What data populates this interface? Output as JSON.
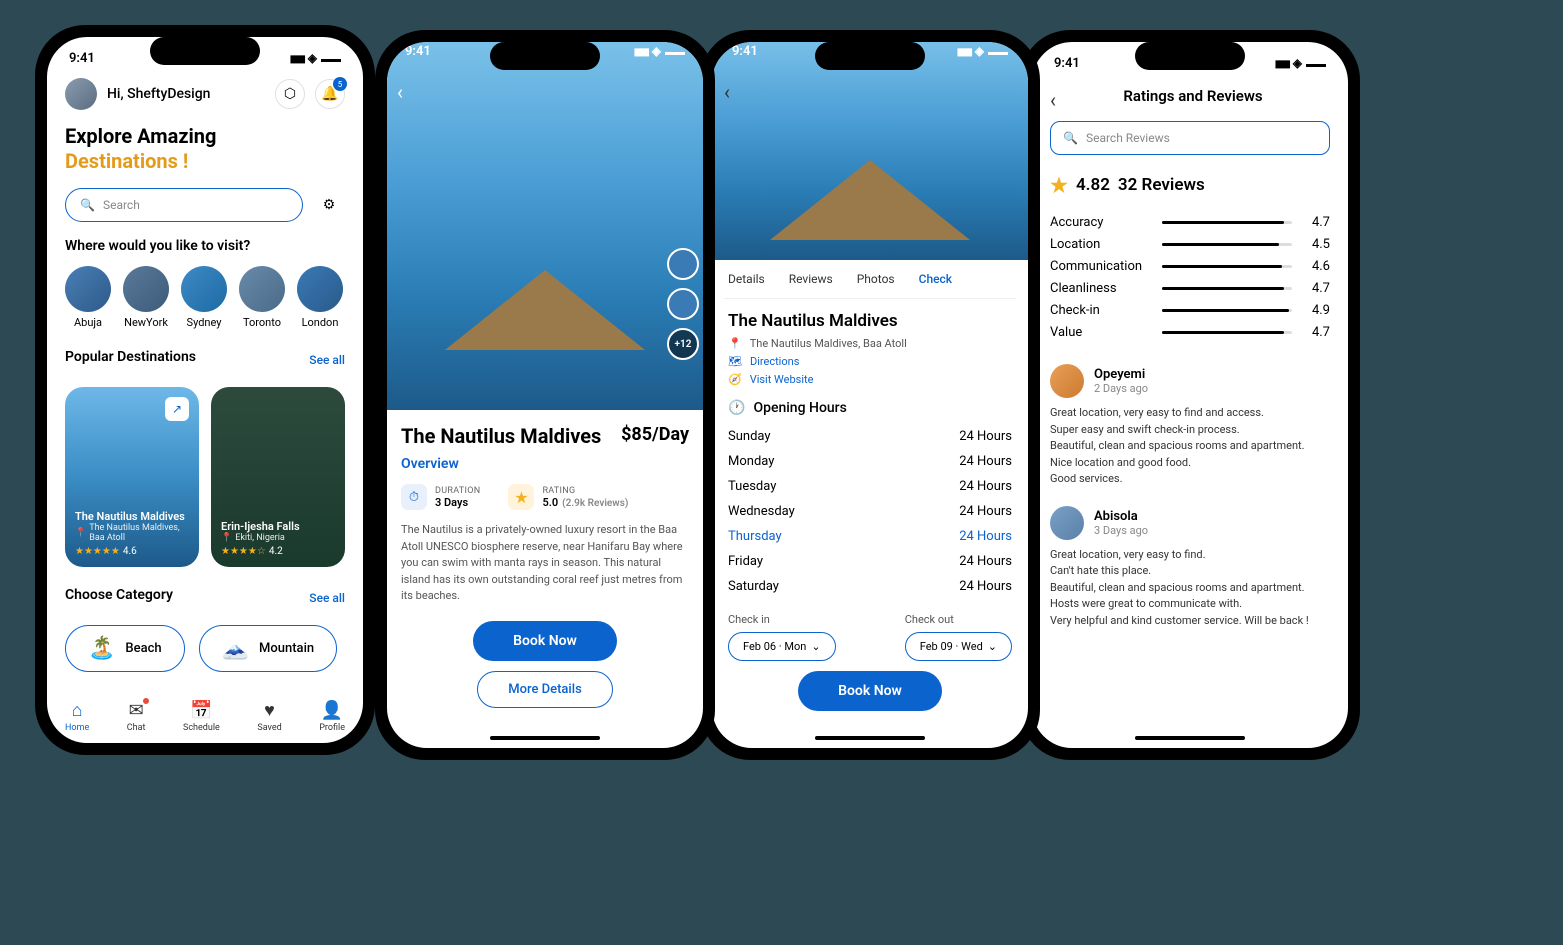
{
  "status": {
    "time": "9:41"
  },
  "screen1": {
    "greeting": "Hi, SheftyDesign",
    "notif_count": "5",
    "hero_line1": "Explore Amazing",
    "hero_line2": "Destinations !",
    "search_placeholder": "Search",
    "visit_question": "Where would you like to visit?",
    "cities": [
      "Abuja",
      "NewYork",
      "Sydney",
      "Toronto",
      "London"
    ],
    "popular_title": "Popular Destinations",
    "see_all": "See all",
    "destinations": [
      {
        "name": "The Nautilus Maldives",
        "location": "The Nautilus Maldives, Baa Atoll",
        "rating": "4.6"
      },
      {
        "name": "Erin-Ijesha Falls",
        "location": "Ekiti, Nigeria",
        "rating": "4.2"
      }
    ],
    "category_title": "Choose Category",
    "categories": [
      {
        "emoji": "🏝️",
        "label": "Beach"
      },
      {
        "emoji": "🗻",
        "label": "Mountain"
      }
    ],
    "nav": [
      "Home",
      "Chat",
      "Schedule",
      "Saved",
      "Profile"
    ]
  },
  "screen2": {
    "thumb_more": "+12",
    "place_name": "The Nautilus Maldives",
    "price": "$85/Day",
    "overview": "Overview",
    "duration_label": "DURATION",
    "duration_value": "3 Days",
    "rating_label": "RATING",
    "rating_value": "5.0",
    "rating_count": "(2.9k Reviews)",
    "description": "The Nautilus is a privately-owned luxury resort in the Baa Atoll UNESCO biosphere reserve, near Hanifaru Bay where you can swim with manta rays in season. This natural island has its own outstanding coral reef just metres from its beaches.",
    "book_now": "Book Now",
    "more_details": "More Details"
  },
  "screen3": {
    "tabs": [
      "Details",
      "Reviews",
      "Photos",
      "Check"
    ],
    "place_name": "The Nautilus Maldives",
    "address": "The Nautilus Maldives, Baa Atoll",
    "directions": "Directions",
    "website": "Visit Website",
    "hours_title": "Opening Hours",
    "hours": [
      {
        "day": "Sunday",
        "time": "24 Hours"
      },
      {
        "day": "Monday",
        "time": "24 Hours"
      },
      {
        "day": "Tuesday",
        "time": "24 Hours"
      },
      {
        "day": "Wednesday",
        "time": "24 Hours"
      },
      {
        "day": "Thursday",
        "time": "24 Hours"
      },
      {
        "day": "Friday",
        "time": "24 Hours"
      },
      {
        "day": "Saturday",
        "time": "24 Hours"
      }
    ],
    "today_index": 4,
    "checkin_label": "Check in",
    "checkout_label": "Check out",
    "checkin_value": "Feb 06 · Mon",
    "checkout_value": "Feb 09 · Wed",
    "book_now": "Book Now"
  },
  "screen4": {
    "page_title": "Ratings and Reviews",
    "search_placeholder": "Search Reviews",
    "avg_rating": "4.82",
    "review_count": "32 Reviews",
    "categories": [
      {
        "name": "Accuracy",
        "value": "4.7"
      },
      {
        "name": "Location",
        "value": "4.5"
      },
      {
        "name": "Communication",
        "value": "4.6"
      },
      {
        "name": "Cleanliness",
        "value": "4.7"
      },
      {
        "name": "Check-in",
        "value": "4.9"
      },
      {
        "name": "Value",
        "value": "4.7"
      }
    ],
    "reviews": [
      {
        "name": "Opeyemi",
        "time": "2 Days ago",
        "text": "Great location, very easy to find and access.\nSuper easy and swift check-in process.\nBeautiful, clean and spacious rooms and apartment.\nNice location and good food.\nGood services."
      },
      {
        "name": "Abisola",
        "time": "3 Days ago",
        "text": "Great location, very easy to find.\nCan't hate this place.\nBeautiful, clean and spacious rooms and apartment.\nHosts were great to communicate with.\nVery helpful and kind customer service. Will be back !"
      }
    ]
  }
}
